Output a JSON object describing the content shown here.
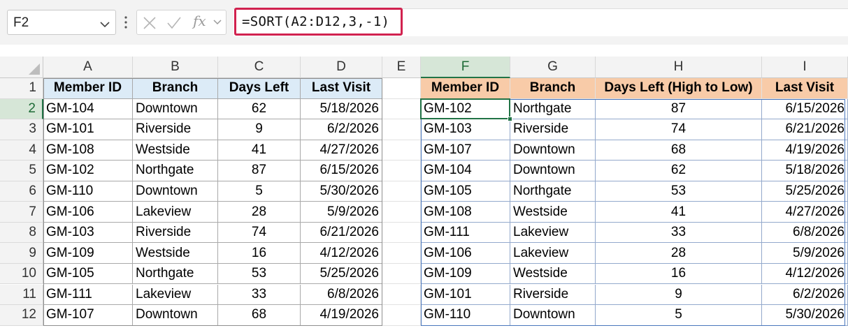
{
  "formula_bar": {
    "name_box": "F2",
    "fx_label": "fx",
    "formula": "=SORT(A2:D12,3,-1)"
  },
  "columns": [
    "A",
    "B",
    "C",
    "D",
    "E",
    "F",
    "G",
    "H",
    "I"
  ],
  "active_column": "F",
  "rows": [
    "1",
    "2",
    "3",
    "4",
    "5",
    "6",
    "7",
    "8",
    "9",
    "10",
    "11",
    "12"
  ],
  "active_row": "2",
  "source_table": {
    "headers": [
      "Member ID",
      "Branch",
      "Days Left",
      "Last Visit"
    ],
    "rows": [
      [
        "GM-104",
        "Downtown",
        "62",
        "5/18/2026"
      ],
      [
        "GM-101",
        "Riverside",
        "9",
        "6/2/2026"
      ],
      [
        "GM-108",
        "Westside",
        "41",
        "4/27/2026"
      ],
      [
        "GM-102",
        "Northgate",
        "87",
        "6/15/2026"
      ],
      [
        "GM-110",
        "Downtown",
        "5",
        "5/30/2026"
      ],
      [
        "GM-106",
        "Lakeview",
        "28",
        "5/9/2026"
      ],
      [
        "GM-103",
        "Riverside",
        "74",
        "6/21/2026"
      ],
      [
        "GM-109",
        "Westside",
        "16",
        "4/12/2026"
      ],
      [
        "GM-105",
        "Northgate",
        "53",
        "5/25/2026"
      ],
      [
        "GM-111",
        "Lakeview",
        "33",
        "6/8/2026"
      ],
      [
        "GM-107",
        "Downtown",
        "68",
        "4/19/2026"
      ]
    ]
  },
  "sorted_table": {
    "headers": [
      "Member ID",
      "Branch",
      "Days Left (High to Low)",
      "Last Visit"
    ],
    "rows": [
      [
        "GM-102",
        "Northgate",
        "87",
        "6/15/2026"
      ],
      [
        "GM-103",
        "Riverside",
        "74",
        "6/21/2026"
      ],
      [
        "GM-107",
        "Downtown",
        "68",
        "4/19/2026"
      ],
      [
        "GM-104",
        "Downtown",
        "62",
        "5/18/2026"
      ],
      [
        "GM-105",
        "Northgate",
        "53",
        "5/25/2026"
      ],
      [
        "GM-108",
        "Westside",
        "41",
        "4/27/2026"
      ],
      [
        "GM-111",
        "Lakeview",
        "33",
        "6/8/2026"
      ],
      [
        "GM-106",
        "Lakeview",
        "28",
        "5/9/2026"
      ],
      [
        "GM-109",
        "Westside",
        "16",
        "4/12/2026"
      ],
      [
        "GM-101",
        "Riverside",
        "9",
        "6/2/2026"
      ],
      [
        "GM-110",
        "Downtown",
        "5",
        "5/30/2026"
      ]
    ]
  },
  "colors": {
    "source_header_fill": "#dcebf7",
    "sorted_header_fill": "#f8cba8",
    "formula_highlight": "#d1224f",
    "selection": "#217346",
    "spill_border": "#4a77bd"
  },
  "icons": [
    "chevron-down-icon",
    "more-options-icon",
    "cancel-icon",
    "enter-icon",
    "insert-function-icon",
    "select-all-icon"
  ]
}
